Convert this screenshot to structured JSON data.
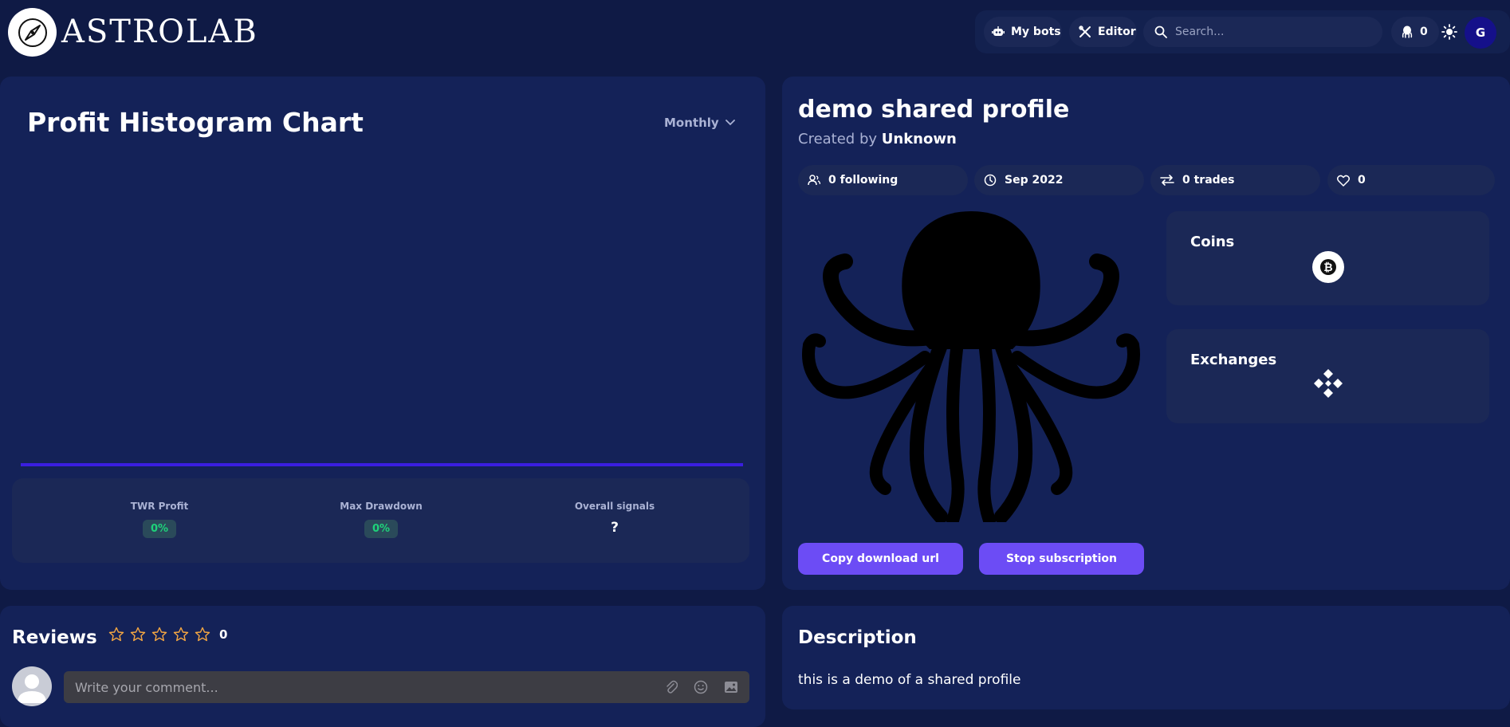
{
  "header": {
    "logo_text": "ASTROLAB",
    "nav": {
      "my_bots": "My bots",
      "editor": "Editor",
      "search_placeholder": "Search...",
      "bot_count": "0",
      "user_initial": "G"
    }
  },
  "chart_panel": {
    "title": "Profit Histogram Chart",
    "period": "Monthly",
    "stats": [
      {
        "label": "TWR Profit",
        "value": "0%"
      },
      {
        "label": "Max Drawdown",
        "value": "0%"
      },
      {
        "label": "Overall signals",
        "value": "?"
      }
    ]
  },
  "chart_data": {
    "type": "bar",
    "title": "Profit Histogram Chart",
    "categories": [],
    "values": [],
    "baseline_color": "#3a1ee0"
  },
  "profile": {
    "title": "demo shared profile",
    "created_by_prefix": "Created by",
    "author": "Unknown",
    "info": {
      "following": "0 following",
      "date": "Sep 2022",
      "trades": "0 trades",
      "likes": "0"
    },
    "coins_title": "Coins",
    "exchanges_title": "Exchanges",
    "copy_button": "Copy download url",
    "stop_button": "Stop subscription"
  },
  "reviews": {
    "title": "Reviews",
    "count": "0",
    "comment_placeholder": "Write your comment..."
  },
  "description": {
    "title": "Description",
    "text": "this is a demo of a shared profile"
  },
  "colors": {
    "background": "#0f1a45",
    "panel": "#142258",
    "accent": "#6c4cf5",
    "positive": "#1ed37a"
  }
}
